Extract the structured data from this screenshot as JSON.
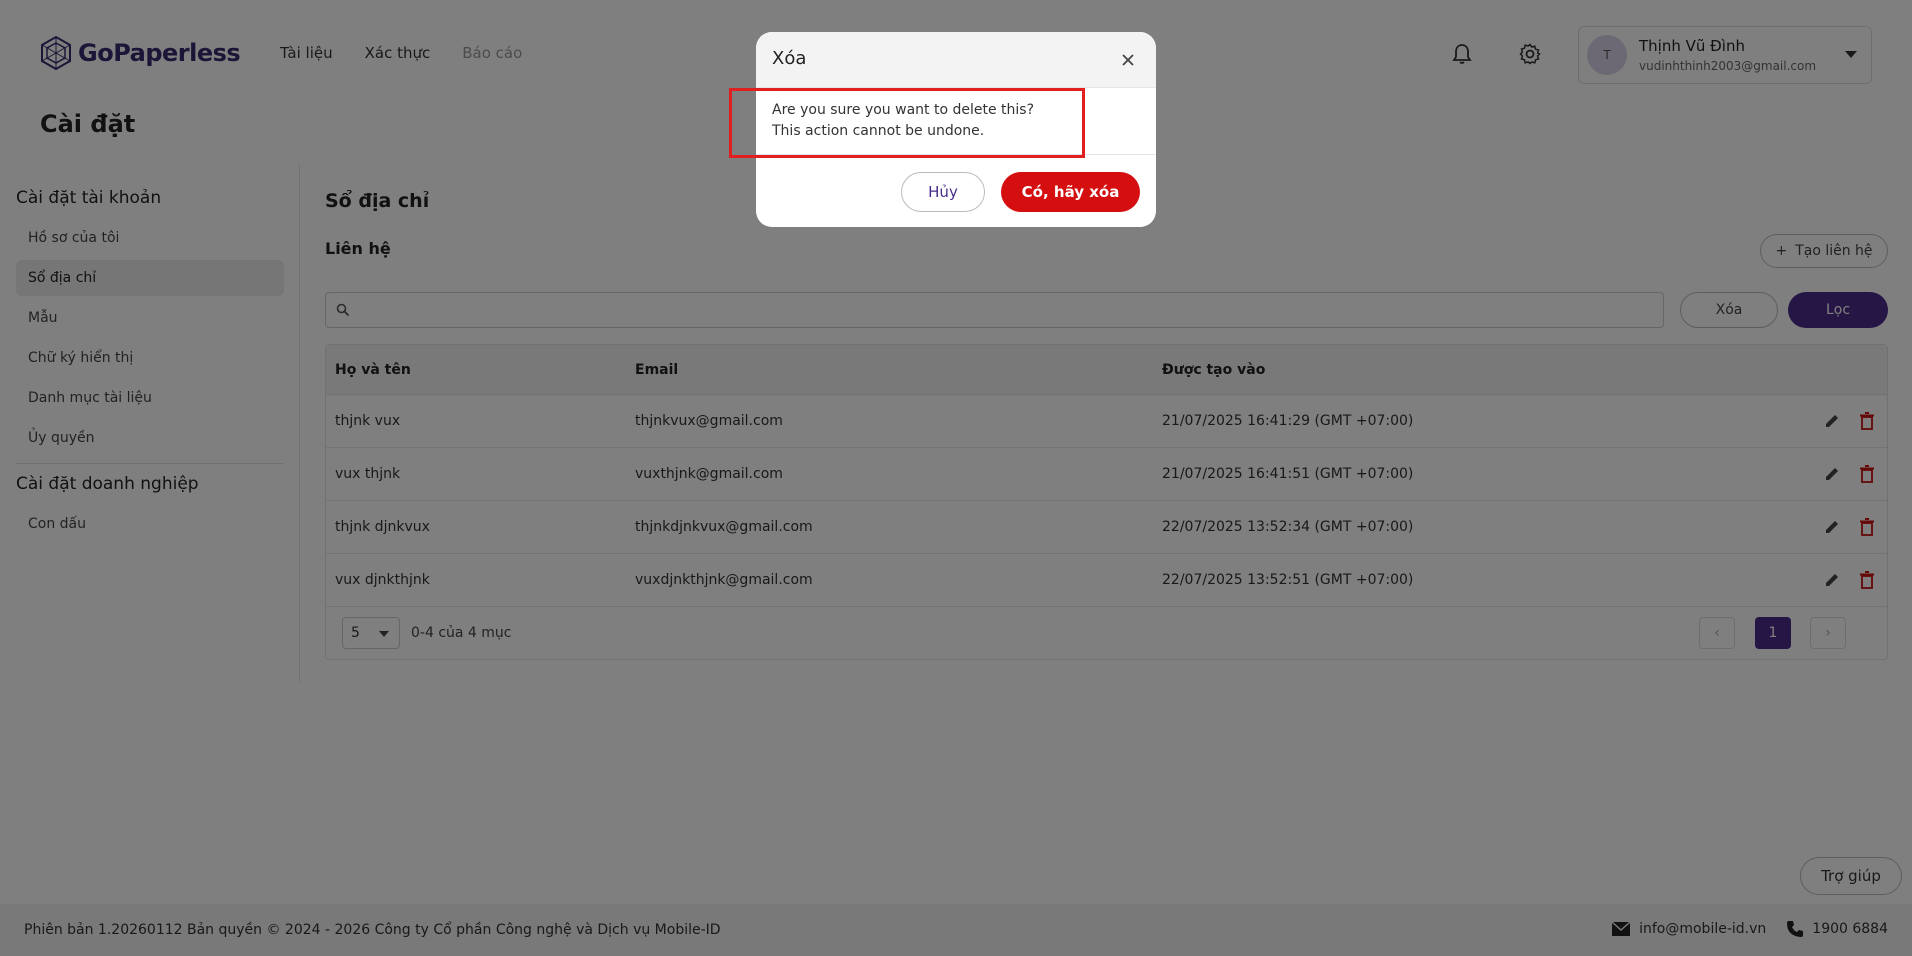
{
  "header": {
    "logo_text": "GoPaperless",
    "nav": [
      "Tài liệu",
      "Xác thực",
      "Báo cáo"
    ],
    "user": {
      "initial": "T",
      "name": "Thịnh Vũ Đình",
      "email": "vudinhthinh2003@gmail.com"
    },
    "icons": [
      "bell-icon",
      "gear-icon"
    ]
  },
  "page": {
    "title": "Cài đặt"
  },
  "sidebar": {
    "account_group": "Cài đặt tài khoản",
    "account_items": [
      "Hồ sơ của tôi",
      "Sổ địa chỉ",
      "Mẫu",
      "Chữ ký hiển thị",
      "Danh mục tài liệu",
      "Ủy quyền"
    ],
    "active_item": "Sổ địa chỉ",
    "business_group": "Cài đặt doanh nghiệp",
    "business_items": [
      "Con dấu"
    ]
  },
  "main": {
    "section_title": "Sổ địa chỉ",
    "sub_title": "Liên hệ",
    "create_button": "Tạo liên hệ",
    "search_placeholder": "",
    "clear_button": "Xóa",
    "filter_button": "Lọc",
    "columns": [
      "Họ và tên",
      "Email",
      "Được tạo vào"
    ],
    "rows": [
      {
        "name": "thjnk vux",
        "email": "thjnkvux@gmail.com",
        "created": "21/07/2025 16:41:29 (GMT +07:00)"
      },
      {
        "name": "vux thjnk",
        "email": "vuxthjnk@gmail.com",
        "created": "21/07/2025 16:41:51 (GMT +07:00)"
      },
      {
        "name": "thjnk djnkvux",
        "email": "thjnkdjnkvux@gmail.com",
        "created": "22/07/2025 13:52:34 (GMT +07:00)"
      },
      {
        "name": "vux djnkthjnk",
        "email": "vuxdjnkthjnk@gmail.com",
        "created": "22/07/2025 13:52:51 (GMT +07:00)"
      }
    ],
    "page_size": "5",
    "range_text": "0-4 của 4 mục",
    "current_page": "1"
  },
  "help_button": "Trợ giúp",
  "footer": {
    "left": "Phiên bản 1.20260112 Bản quyền © 2024 - 2026 Công ty Cổ phần Công nghệ và Dịch vụ Mobile-ID",
    "email": "info@mobile-id.vn",
    "phone": "1900 6884"
  },
  "modal": {
    "title": "Xóa",
    "body_line1": "Are you sure you want to delete this?",
    "body_line2": "This action cannot be undone.",
    "cancel": "Hủy",
    "confirm": "Có, hãy xóa"
  },
  "colors": {
    "brand": "#4a2c8a",
    "danger": "#d50f0f",
    "highlight": "#e02020"
  }
}
